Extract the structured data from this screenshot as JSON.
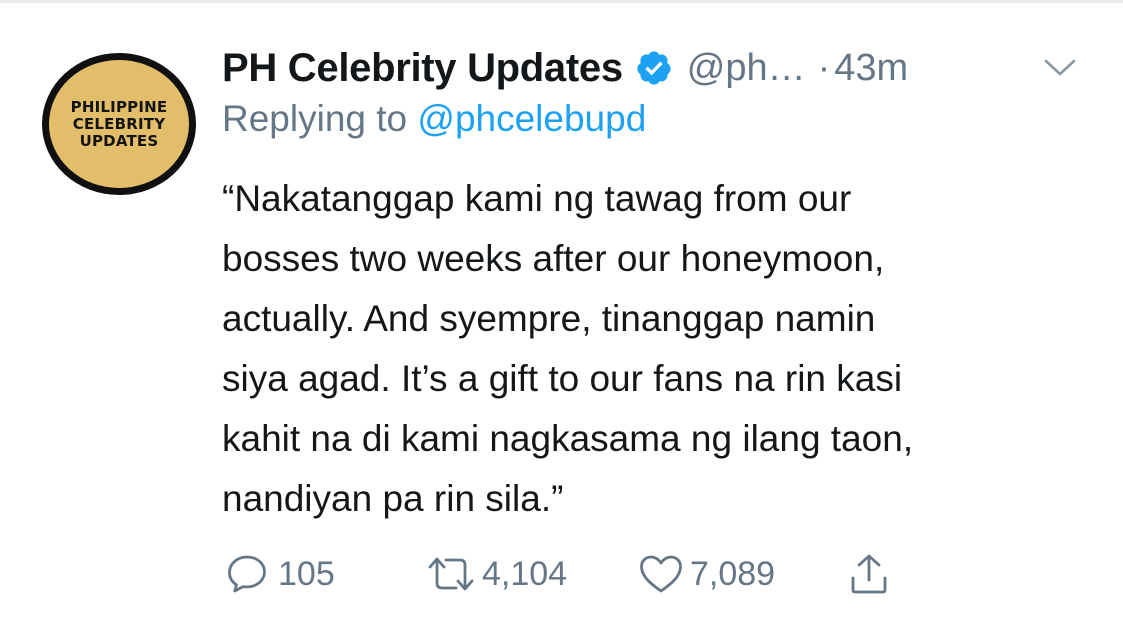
{
  "tweet": {
    "display_name": "PH Celebrity Updates",
    "verified_icon": "verified-badge-icon",
    "handle": "@ph…",
    "separator": "·",
    "time": "43m",
    "menu_icon": "chevron-down-icon",
    "avatar": {
      "line1": "PHILIPPINE",
      "line2": "CELEBRITY",
      "line3": "UPDATES",
      "ring_color": "#101010",
      "fill_color": "#e2bd6a"
    },
    "reply": {
      "prefix": "Replying to",
      "mention": "@phcelebupd"
    },
    "text_lines": [
      "“Nakatanggap kami ng tawag from our",
      "bosses two weeks after our honeymoon,",
      "actually. And syempre, tinanggap namin",
      "siya agad. It’s a gift to our fans na rin kasi",
      "kahit na di kami nagkasama ng ilang taon,",
      "nandiyan pa rin sila.”"
    ],
    "actions": {
      "reply_count": "105",
      "retweet_count": "4,104",
      "like_count": "7,089",
      "reply_icon": "reply-bubble-icon",
      "retweet_icon": "retweet-icon",
      "like_icon": "heart-icon",
      "share_icon": "share-icon"
    },
    "colors": {
      "name": "#14171a",
      "secondary": "#657786",
      "link": "#1da1f2",
      "verified": "#1da1f2"
    }
  }
}
